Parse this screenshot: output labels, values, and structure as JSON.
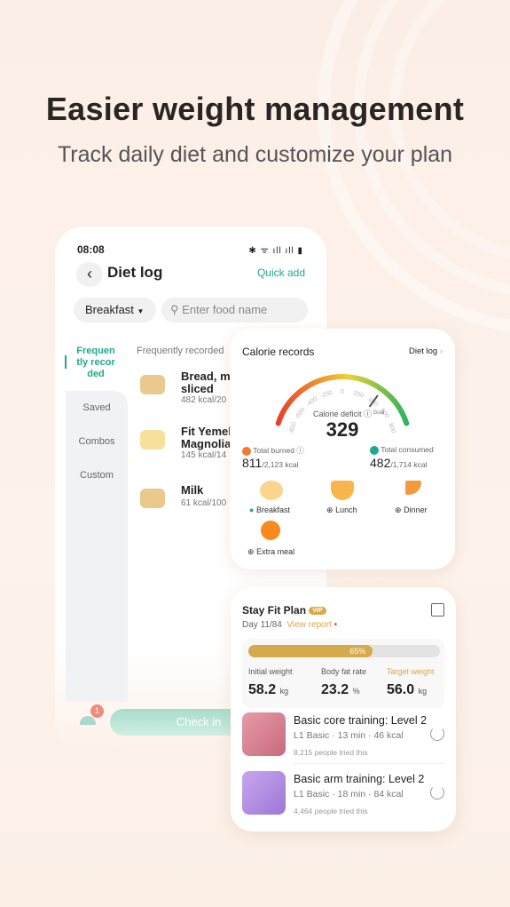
{
  "headline": "Easier weight management",
  "subheadline": "Track daily diet and customize your plan",
  "phone": {
    "time": "08:08",
    "status_icons": "✱ ᯤ ıll ıll ▮",
    "title": "Diet log",
    "quick_add": "Quick add",
    "meal_select": "Breakfast",
    "search_placeholder": "Enter food name",
    "sidebar": [
      "Frequen\ntly recor\nded",
      "Saved",
      "Combos",
      "Custom"
    ],
    "list_header": "Frequently recorded",
    "foods": [
      {
        "name": "Bread, mi\nsliced",
        "kcal": "482 kcal/20"
      },
      {
        "name": "Fit Yemek\nMagnolia",
        "kcal": "145 kcal/14"
      },
      {
        "name": "Milk",
        "kcal": "61 kcal/100"
      }
    ],
    "badge": "1",
    "check_in": "Check in"
  },
  "calorie": {
    "title": "Calorie records",
    "link": "Diet log",
    "gauge_labels": [
      "-800",
      "-600",
      "-400",
      "-200",
      "0",
      "200",
      "400",
      "600",
      "800"
    ],
    "goal_label": "Goal",
    "deficit_label": "Calorie deficit",
    "deficit": "329",
    "burned_label": "Total burned",
    "burned": "811",
    "burned_total": "/2,123 kcal",
    "consumed_label": "Total consumed",
    "consumed": "482",
    "consumed_total": "/1,714 kcal",
    "meals": [
      {
        "label": "Breakfast",
        "done": true
      },
      {
        "label": "Lunch",
        "done": false
      },
      {
        "label": "Dinner",
        "done": false
      },
      {
        "label": "Extra meal",
        "done": false
      }
    ],
    "colors": {
      "accent": "#1fa88f",
      "burn": "#ef7a30"
    }
  },
  "plan": {
    "title": "Stay Fit Plan",
    "vip": "VIP",
    "day": "Day 11/84",
    "report": "View report",
    "progress_pct": 65,
    "progress_label": "65%",
    "stats": [
      {
        "label": "Initial weight",
        "value": "58.2",
        "unit": "kg"
      },
      {
        "label": "Body fat rate",
        "value": "23.2",
        "unit": "%"
      },
      {
        "label": "Target weight",
        "value": "56.0",
        "unit": "kg"
      }
    ],
    "trainings": [
      {
        "title": "Basic core training: Level 2",
        "meta": "L1 Basic · 13 min · 46 kcal",
        "people": "8,215 people tried this"
      },
      {
        "title": "Basic arm  training: Level 2",
        "meta": "L1 Basic · 18 min · 84 kcal",
        "people": "4,464 people tried this"
      }
    ],
    "colors": {
      "gold": "#d6a94a"
    }
  }
}
